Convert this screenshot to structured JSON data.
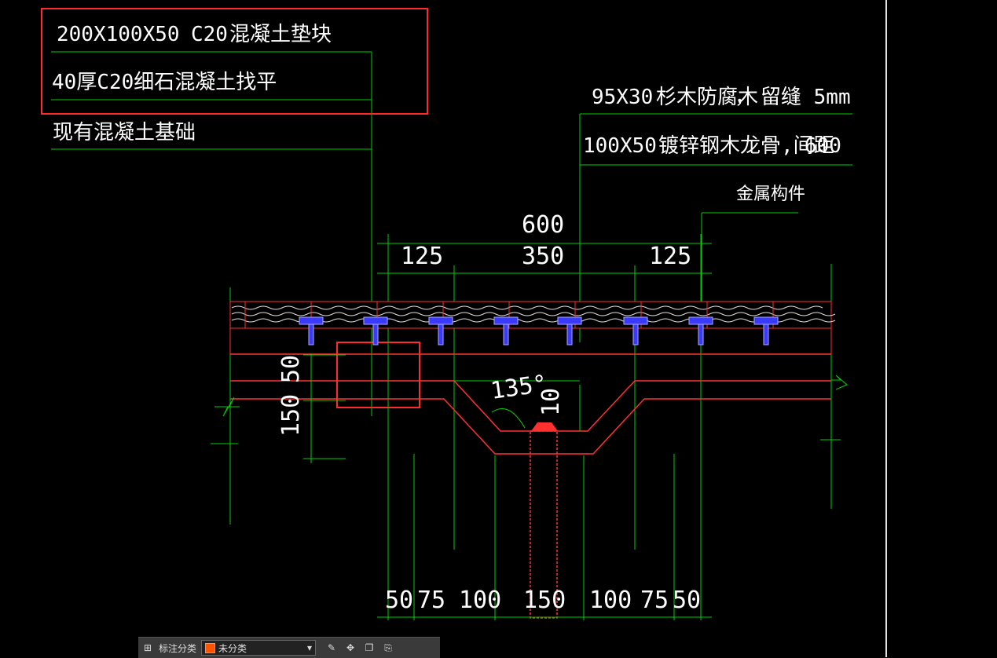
{
  "annotations": {
    "pad": {
      "size": "200X100X50",
      "grade": "C20",
      "name": "混凝土垫块"
    },
    "screed": "40厚C20细石混凝土找平",
    "foundation": "现有混凝土基础",
    "decking": {
      "size": "95X30",
      "name": "杉木防腐木",
      "sep": "，",
      "gap": "留缝 5mm"
    },
    "joist": {
      "size": "100X50",
      "name": "镀锌钢木龙骨,间距",
      "spacing": "600"
    },
    "fitting": "金属构件"
  },
  "dimensions": {
    "total": "600",
    "top": [
      "125",
      "350",
      "125"
    ],
    "left": [
      "50",
      "150"
    ],
    "angle": "135°",
    "small": "10",
    "bottom": [
      "50",
      "75",
      "100",
      "150",
      "100",
      "75",
      "50"
    ]
  },
  "toolbar": {
    "label": "标注分类",
    "select_value": "未分类"
  },
  "colors": {
    "highlight": "#ff2a2a",
    "leader": "#00ff00",
    "structure": "#ff3030",
    "fastener": "#3a3aff"
  }
}
